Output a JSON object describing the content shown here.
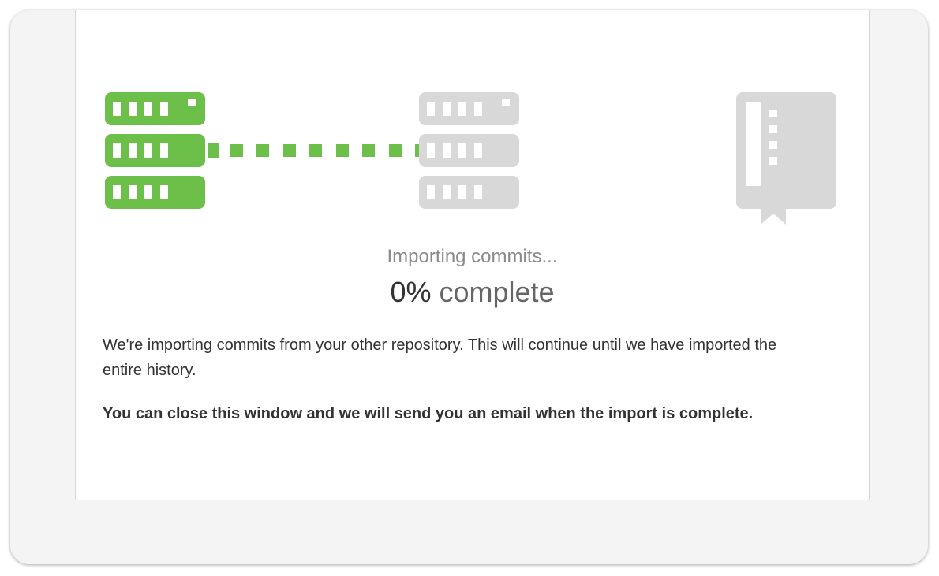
{
  "import": {
    "status": "Importing commits...",
    "percent": "0%",
    "complete_label": " complete",
    "progress_value": 0
  },
  "message": {
    "description": "We're importing commits from your other repository. This will continue until we have imported the entire history.",
    "notice": "You can close this window and we will send you an email when the import is complete."
  },
  "icons": {
    "source": "server-icon",
    "destination": "server-icon",
    "result": "repository-book-icon",
    "connector": "dotted-transfer-line"
  },
  "colors": {
    "active": "#6cc04a",
    "inactive": "#d8d8d8",
    "text": "#333333",
    "muted": "#8a8a8a"
  }
}
